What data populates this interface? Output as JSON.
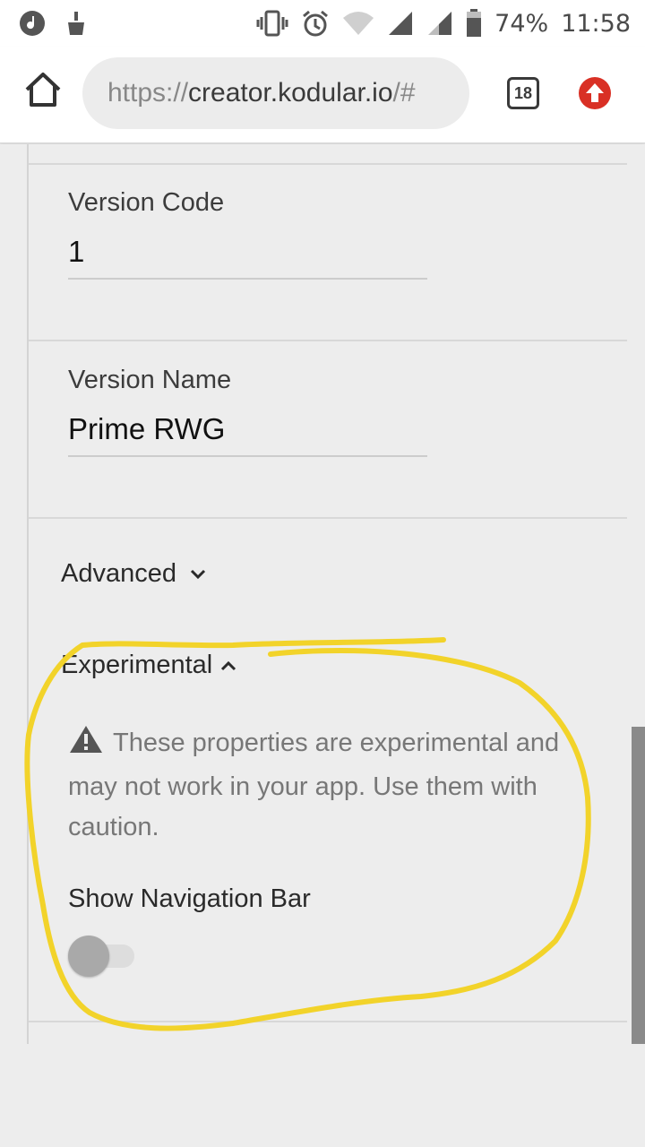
{
  "status_bar": {
    "battery_percent": "74%",
    "time": "11:58",
    "icons": [
      "music-icon",
      "cleaner-icon",
      "vibrate-icon",
      "alarm-icon",
      "wifi-icon",
      "signal-icon",
      "signal-icon",
      "battery-icon"
    ]
  },
  "browser": {
    "url_scheme": "https://",
    "url_host": "creator.kodular.io",
    "url_hash": "/#",
    "tab_count": "18"
  },
  "properties": {
    "version_code": {
      "label": "Version Code",
      "value": "1"
    },
    "version_name": {
      "label": "Version Name",
      "value": "Prime RWG"
    },
    "advanced": {
      "label": "Advanced"
    },
    "experimental": {
      "label": "Experimental",
      "warning": "These properties are experimental and may not work in your app. Use them with caution.",
      "show_navigation_bar": {
        "label": "Show Navigation Bar",
        "enabled": false
      }
    }
  },
  "colors": {
    "accent_update": "#d93025",
    "highlight_marker": "#f2d32a"
  }
}
